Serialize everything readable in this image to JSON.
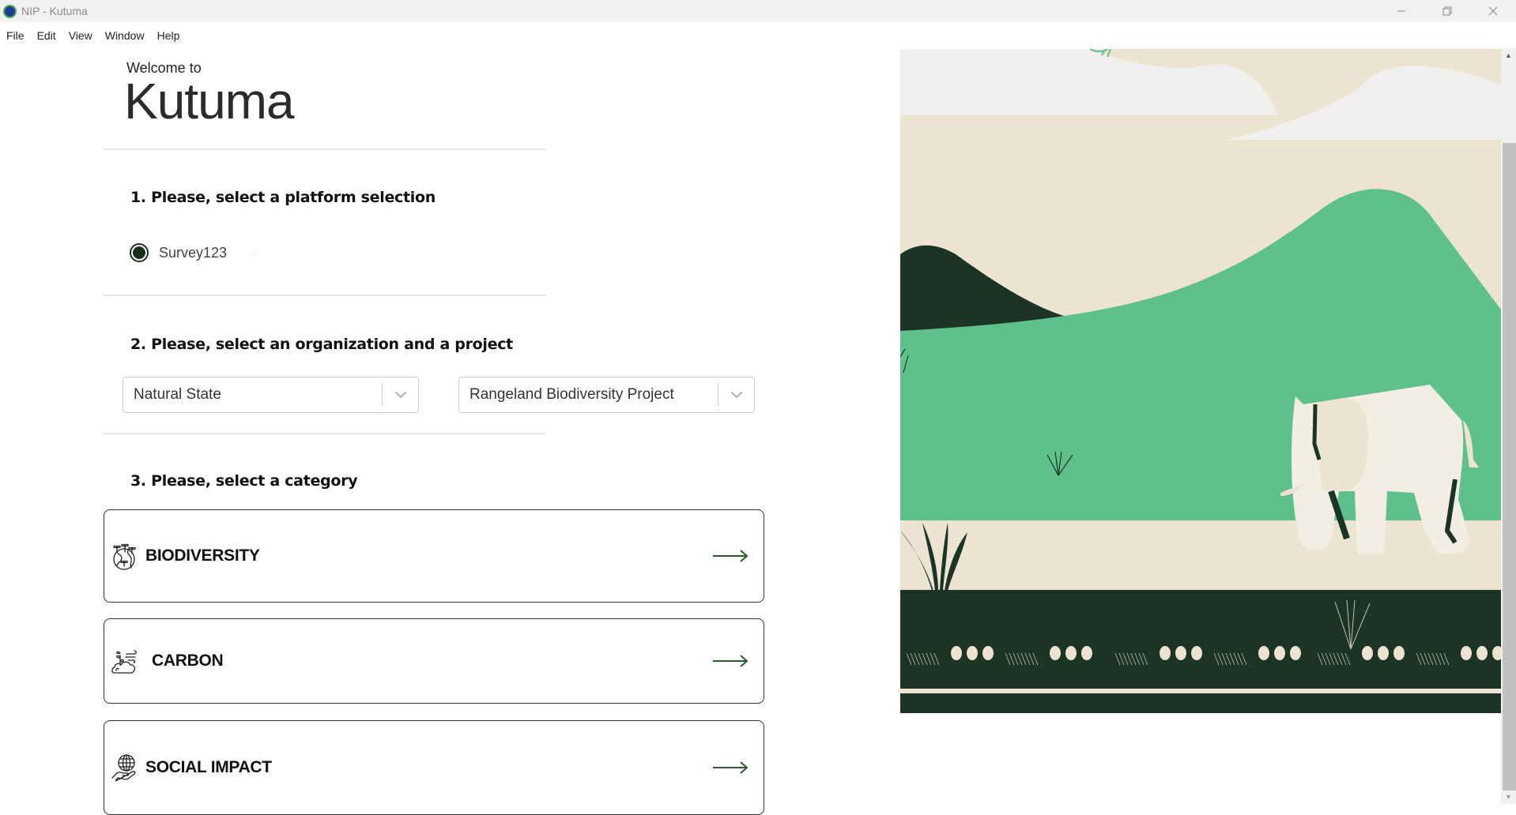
{
  "window": {
    "title": "NIP - Kutuma",
    "controls": {
      "minimize": "—",
      "restore": "❐",
      "close": "✕"
    }
  },
  "menu": [
    "File",
    "Edit",
    "View",
    "Window",
    "Help"
  ],
  "header": {
    "welcome": "Welcome to",
    "brand": "Kutuma"
  },
  "step1": {
    "heading": "1. Please, select a platform selection",
    "options": [
      {
        "label": "Survey123",
        "selected": true
      }
    ]
  },
  "step2": {
    "heading": "2. Please, select an organization and a project",
    "organization": {
      "value": "Natural State"
    },
    "project": {
      "value": "Rangeland Biodiversity Project"
    }
  },
  "step3": {
    "heading": "3. Please, select a category",
    "categories": [
      {
        "label": "BIODIVERSITY",
        "icon": "biodiversity-globe-sprouts-icon"
      },
      {
        "label": "CARBON",
        "icon": "carbon-cloud-plant-icon"
      },
      {
        "label": "SOCIAL IMPACT",
        "icon": "social-impact-hand-globe-icon"
      }
    ]
  },
  "colors": {
    "sky": "#ece4d1",
    "cloud": "#f0efed",
    "hill_green": "#5fc08b",
    "dark_green": "#1c3425",
    "sand": "#ece4d1",
    "elephant": "#f3eee4",
    "arrow": "#2e5a2e"
  },
  "illustration": {
    "subject": "elephant-savanna-scene"
  }
}
